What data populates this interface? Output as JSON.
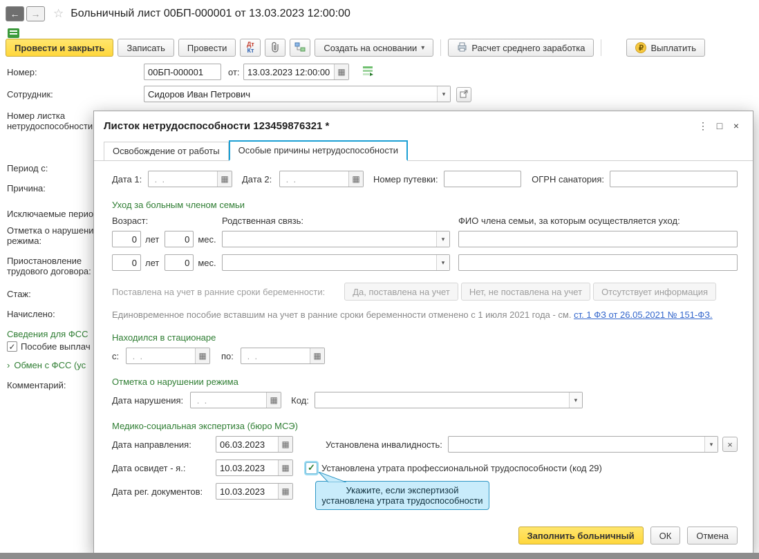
{
  "colors": {
    "accent_yellow": "#ffd73c",
    "section_green": "#2e7d32",
    "link_blue": "#3366cc",
    "tab_teal": "#1b9fd4",
    "tooltip_bg": "#c9ecfb"
  },
  "icons": {
    "back": "←",
    "forward": "→",
    "star": "☆",
    "calendar": "▦",
    "dropdown": "▾",
    "caret": "▾",
    "clear": "×",
    "menu": "⋮",
    "maximize": "□",
    "close": "×",
    "ruble": "₽",
    "check": "✓",
    "chevron": "›"
  },
  "titlebar": {
    "title": "Больничный лист 00БП-000001 от 13.03.2023 12:00:00"
  },
  "toolbar": {
    "post_close": "Провести и закрыть",
    "write": "Записать",
    "post": "Провести",
    "dt": "Дт",
    "kt": "Кт",
    "create_on_basis": "Создать на основании",
    "avg_earnings": "Расчет среднего заработка",
    "pay": "Выплатить"
  },
  "form": {
    "number_label": "Номер:",
    "number_value": "00БП-000001",
    "from_label": "от:",
    "date_value": "13.03.2023 12:00:00",
    "employee_label": "Сотрудник:",
    "employee_value": "Сидоров Иван Петрович",
    "sick_number_line1": "Номер листка",
    "sick_number_line2": "нетрудоспособности:",
    "period_label": "Период с:",
    "reason_label": "Причина:",
    "excluded_label": "Исключаемые перио",
    "violation_line1": "Отметка о нарушени",
    "violation_line2": "режима:",
    "suspension_line1": "Приостановление",
    "suspension_line2": "трудового договора:",
    "experience_label": "Стаж:",
    "accrued_label": "Начислено:",
    "fss_header": "Сведения для ФСС",
    "benefit_label": "Пособие выплач",
    "fss_exchange_label": "Обмен с ФСС (ус",
    "comment_label": "Комментарий:"
  },
  "dialog": {
    "title": "Листок нетрудоспособности 123459876321 *",
    "tabs": [
      {
        "label": "Освобождение от работы"
      },
      {
        "label": "Особые причины нетрудоспособности"
      }
    ],
    "row_dates": {
      "date1_label": "Дата 1:",
      "date2_label": "Дата 2:",
      "empty_date": " .  .",
      "voucher_label": "Номер путевки:",
      "ogrn_label": "ОГРН санатория:"
    },
    "care": {
      "header": "Уход за больным членом семьи",
      "age_label": "Возраст:",
      "relation_label": "Родственная связь:",
      "fio_label": "ФИО члена семьи, за которым осуществляется уход:",
      "years_label": "лет",
      "months_label": "мес.",
      "age_value": "0"
    },
    "pregnancy": {
      "label": "Поставлена на учет в ранние сроки беременности:",
      "btn_yes": "Да, поставлена на учет",
      "btn_no": "Нет, не поставлена на учет",
      "btn_unknown": "Отсутствует информация",
      "note": "Единовременное пособие вставшим на учет в ранние сроки беременности отменено с 1 июля 2021 года - см.",
      "note_link": "ст. 1 ФЗ от 26.05.2021 № 151-ФЗ."
    },
    "hospital": {
      "header": "Находился в стационаре",
      "from_label": "с:",
      "to_label": "по:"
    },
    "violation": {
      "header": "Отметка о нарушении режима",
      "date_label": "Дата нарушения:",
      "code_label": "Код:"
    },
    "mse": {
      "header": "Медико-социальная экспертиза (бюро МСЭ)",
      "direction_label": "Дата направления:",
      "direction_value": "06.03.2023",
      "disability_label": "Установлена инвалидность:",
      "exam_label": "Дата освидет - я.:",
      "exam_value": "10.03.2023",
      "loss_label": "Установлена утрата профессиональной трудоспособности (код 29)",
      "docs_label": "Дата рег. документов:",
      "docs_value": "10.03.2023"
    },
    "tooltip": {
      "line1": "Укажите, если экспертизой",
      "line2": "установлена утрата трудоспособности"
    },
    "footer": {
      "fill": "Заполнить больничный",
      "ok": "ОК",
      "cancel": "Отмена"
    }
  }
}
